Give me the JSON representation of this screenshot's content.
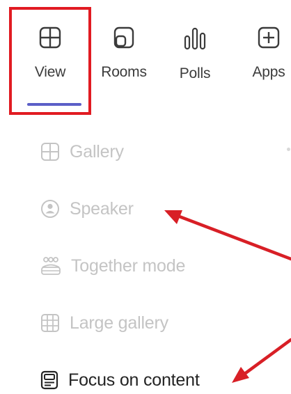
{
  "toolbar": {
    "view_label": "View",
    "rooms_label": "Rooms",
    "polls_label": "Polls",
    "apps_label": "Apps"
  },
  "menu": {
    "items": [
      {
        "label": "Gallery",
        "icon": "gallery-icon",
        "enabled": false
      },
      {
        "label": "Speaker",
        "icon": "speaker-icon",
        "enabled": false
      },
      {
        "label": "Together mode",
        "icon": "together-mode-icon",
        "enabled": false
      },
      {
        "label": "Large gallery",
        "icon": "large-gallery-icon",
        "enabled": false
      },
      {
        "label": "Focus on content",
        "icon": "focus-on-content-icon",
        "enabled": true
      }
    ]
  },
  "colors": {
    "accent": "#5b5fc7",
    "highlight": "#e11b22",
    "arrow": "#d81f26",
    "disabled_text": "#c4c4c4",
    "enabled_text": "#242424"
  }
}
